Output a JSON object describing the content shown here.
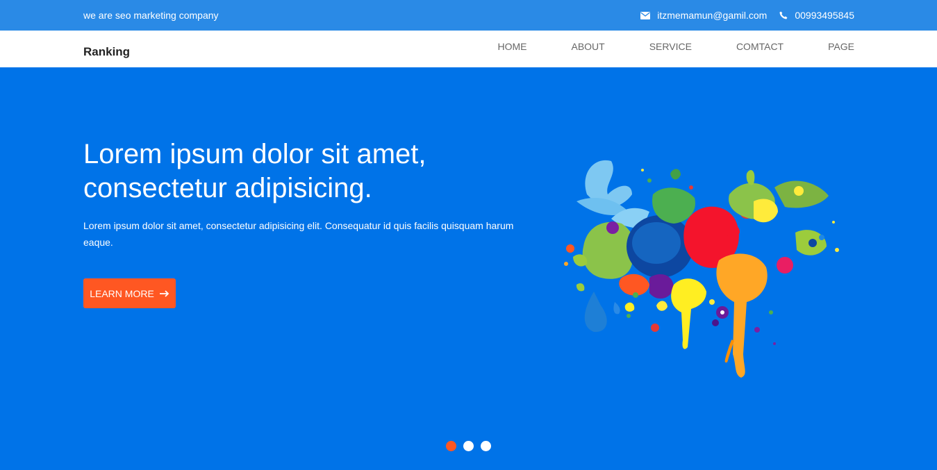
{
  "topbar": {
    "tagline": "we are seo marketing company",
    "email": "itzmemamun@gamil.com",
    "phone": "00993495845",
    "email_icon": "envelope-icon",
    "phone_icon": "phone-icon"
  },
  "navbar": {
    "brand": "Ranking",
    "menu": [
      {
        "label": "HOME"
      },
      {
        "label": "ABOUT"
      },
      {
        "label": "SERVICE"
      },
      {
        "label": "COMTACT"
      },
      {
        "label": "PAGE"
      }
    ]
  },
  "hero": {
    "title": "Lorem ipsum dolor sit amet, consectetur adipisicing.",
    "text": "Lorem ipsum dolor sit amet, consectetur adipisicing elit. Consequatur id quis facilis quisquam harum eaque.",
    "button_label": "LEARN MORE",
    "button_icon": "arrow-right-icon",
    "image": "paint-splash-image"
  },
  "slider": {
    "slide_count": 3,
    "active_index": 0
  },
  "colors": {
    "topbar": "#2a8ae6",
    "hero_bg": "#0073e8",
    "accent": "#ff5722"
  }
}
